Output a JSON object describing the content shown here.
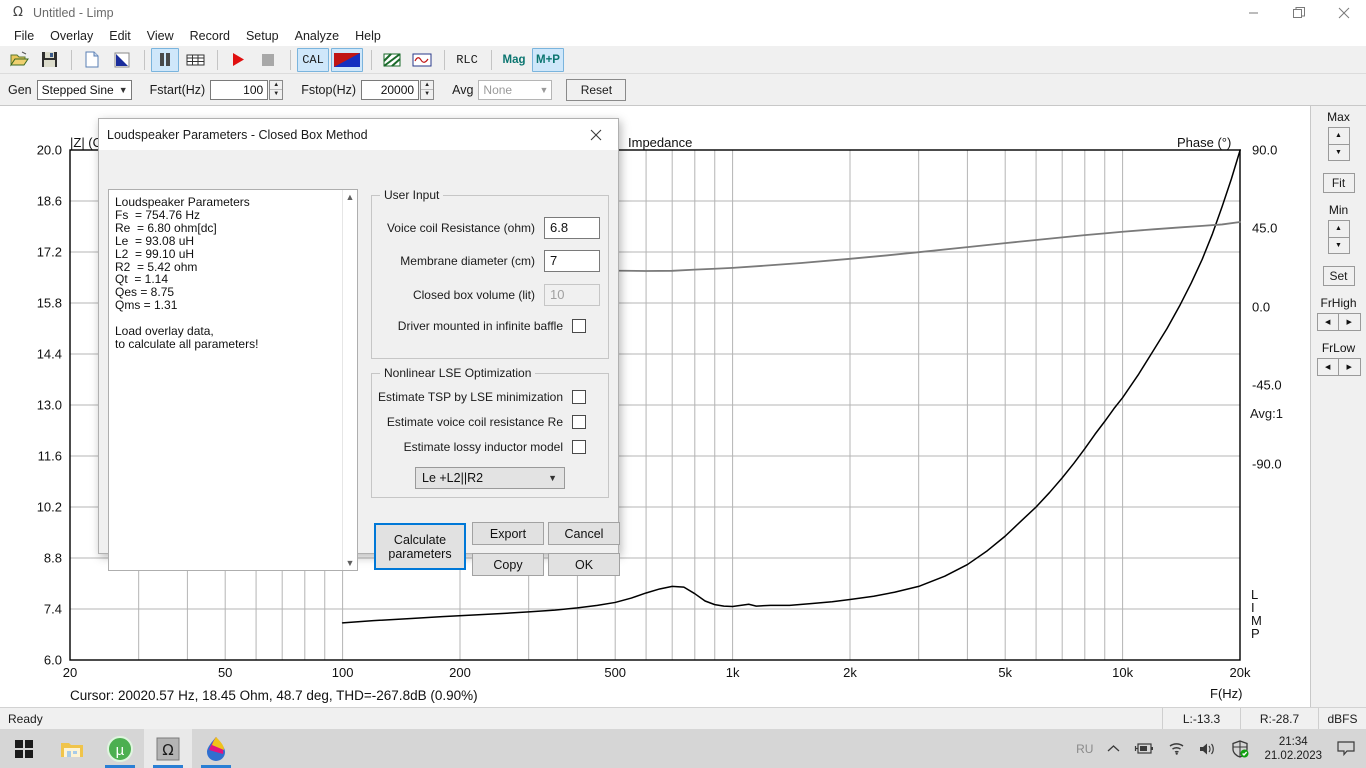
{
  "window": {
    "title": "Untitled - Limp",
    "app_icon": "omega-icon",
    "minimize": "minimize-icon",
    "maximize": "maximize-icon",
    "close": "close-icon"
  },
  "menu": [
    "File",
    "Overlay",
    "Edit",
    "View",
    "Record",
    "Setup",
    "Analyze",
    "Help"
  ],
  "toolbar": {
    "buttons": [
      {
        "name": "open-icon",
        "label": ""
      },
      {
        "name": "save-icon",
        "label": ""
      },
      {
        "name": "new-file-icon",
        "label": ""
      },
      {
        "name": "overlay-icon",
        "label": ""
      },
      {
        "name": "pause-icon",
        "label": "",
        "active": true
      },
      {
        "name": "table-icon",
        "label": ""
      },
      {
        "name": "play-icon",
        "label": ""
      },
      {
        "name": "stop-icon",
        "label": ""
      },
      {
        "name": "cal-icon",
        "label": "CAL",
        "active": true
      },
      {
        "name": "colorbar-icon",
        "label": "",
        "active": true
      },
      {
        "name": "hatched-icon",
        "label": ""
      },
      {
        "name": "waveform-icon",
        "label": ""
      },
      {
        "name": "rlc-icon",
        "label": "RLC"
      },
      {
        "name": "mag-icon",
        "label": "Mag"
      },
      {
        "name": "magphase-icon",
        "label": "M+P",
        "active": true
      }
    ]
  },
  "genbar": {
    "gen_label": "Gen",
    "gen_value": "Stepped Sine",
    "fstart_label": "Fstart(Hz)",
    "fstart_value": "100",
    "fstop_label": "Fstop(Hz)",
    "fstop_value": "20000",
    "avg_label": "Avg",
    "avg_value": "None",
    "reset_label": "Reset"
  },
  "chart_data": {
    "type": "line",
    "title": "Impedance",
    "xlabel": "F(Hz)",
    "ylabel": "|Z| (Ohm)",
    "ylabel_right": "Phase (°)",
    "xscale": "log",
    "xlim": [
      20,
      20000
    ],
    "xticks": [
      20,
      50,
      100,
      200,
      500,
      1000,
      2000,
      5000,
      10000,
      20000
    ],
    "xticklabels": [
      "20",
      "50",
      "100",
      "200",
      "500",
      "1k",
      "2k",
      "5k",
      "10k",
      "20k"
    ],
    "ylim": [
      6.0,
      20.0
    ],
    "yticks": [
      6.0,
      7.4,
      8.8,
      10.2,
      11.6,
      13.0,
      14.4,
      15.8,
      17.2,
      18.6,
      20.0
    ],
    "yticklabels": [
      "6.0",
      "7.4",
      "8.8",
      "10.2",
      "11.6",
      "13.0",
      "14.4",
      "15.8",
      "17.2",
      "18.6",
      "20.0"
    ],
    "ylim_right": [
      -202.5,
      90.0
    ],
    "yticks_right": [
      90.0,
      45.0,
      0.0,
      -45.0,
      -90.0
    ],
    "yticklabels_right": [
      "90.0",
      "45.0",
      "0.0",
      "-45.0",
      "-90.0"
    ],
    "grid": true,
    "avg_label": "Avg:1",
    "watermark": "LIMP",
    "series": [
      {
        "name": "Impedance magnitude",
        "color": "#000000",
        "unit": "Ohm",
        "points": [
          [
            100,
            7.02
          ],
          [
            120,
            7.08
          ],
          [
            150,
            7.14
          ],
          [
            180,
            7.19
          ],
          [
            220,
            7.24
          ],
          [
            260,
            7.28
          ],
          [
            300,
            7.32
          ],
          [
            350,
            7.37
          ],
          [
            400,
            7.43
          ],
          [
            450,
            7.5
          ],
          [
            500,
            7.58
          ],
          [
            550,
            7.7
          ],
          [
            600,
            7.84
          ],
          [
            650,
            7.95
          ],
          [
            700,
            8.02
          ],
          [
            750,
            8.0
          ],
          [
            800,
            7.82
          ],
          [
            850,
            7.62
          ],
          [
            900,
            7.52
          ],
          [
            950,
            7.48
          ],
          [
            1000,
            7.47
          ],
          [
            1100,
            7.53
          ],
          [
            1150,
            7.48
          ],
          [
            1250,
            7.5
          ],
          [
            1400,
            7.5
          ],
          [
            1600,
            7.55
          ],
          [
            1800,
            7.6
          ],
          [
            2000,
            7.66
          ],
          [
            2300,
            7.75
          ],
          [
            2600,
            7.86
          ],
          [
            3000,
            8.02
          ],
          [
            3500,
            8.3
          ],
          [
            4000,
            8.62
          ],
          [
            4500,
            9.0
          ],
          [
            5000,
            9.4
          ],
          [
            5500,
            9.82
          ],
          [
            6000,
            10.2
          ],
          [
            6500,
            10.6
          ],
          [
            7000,
            11.0
          ],
          [
            7500,
            11.4
          ],
          [
            8000,
            11.8
          ],
          [
            8500,
            12.2
          ],
          [
            9000,
            12.55
          ],
          [
            9500,
            12.9
          ],
          [
            10000,
            13.2
          ],
          [
            11000,
            13.85
          ],
          [
            12000,
            14.5
          ],
          [
            13000,
            15.1
          ],
          [
            14000,
            15.72
          ],
          [
            15000,
            16.35
          ],
          [
            16000,
            17.0
          ],
          [
            17000,
            17.7
          ],
          [
            18000,
            18.45
          ],
          [
            19000,
            19.2
          ],
          [
            20020,
            20.0
          ]
        ]
      },
      {
        "name": "Phase",
        "color": "#7a7a7a",
        "unit": "deg",
        "points": [
          [
            100,
            23.0
          ],
          [
            150,
            23.2
          ],
          [
            200,
            23.0
          ],
          [
            300,
            22.4
          ],
          [
            400,
            21.6
          ],
          [
            500,
            20.8
          ],
          [
            600,
            20.6
          ],
          [
            700,
            20.7
          ],
          [
            800,
            21.4
          ],
          [
            900,
            21.9
          ],
          [
            1000,
            22.4
          ],
          [
            1200,
            23.6
          ],
          [
            1500,
            25.2
          ],
          [
            2000,
            27.6
          ],
          [
            2500,
            29.6
          ],
          [
            3000,
            31.4
          ],
          [
            4000,
            34.3
          ],
          [
            5000,
            36.6
          ],
          [
            6000,
            38.4
          ],
          [
            7000,
            39.9
          ],
          [
            8000,
            41.2
          ],
          [
            9000,
            42.2
          ],
          [
            10000,
            43.1
          ],
          [
            12000,
            44.5
          ],
          [
            14000,
            45.6
          ],
          [
            16000,
            46.5
          ],
          [
            18000,
            47.3
          ],
          [
            20020,
            48.7
          ]
        ]
      }
    ],
    "cursor": "Cursor: 20020.57 Hz, 18.45 Ohm, 48.7 deg, THD=-267.8dB (0.90%)"
  },
  "sidepanel": {
    "max_label": "Max",
    "fit_label": "Fit",
    "min_label": "Min",
    "set_label": "Set",
    "frhigh_label": "FrHigh",
    "frlow_label": "FrLow"
  },
  "statusbar": {
    "ready": "Ready",
    "left_level": "L:-13.3",
    "right_level": "R:-28.7",
    "unit": "dBFS"
  },
  "taskbar": {
    "items": [
      {
        "name": "start-button",
        "icon": "windows-logo-icon"
      },
      {
        "name": "file-explorer-button",
        "icon": "folder-icon"
      },
      {
        "name": "utorrent-button",
        "icon": "utorrent-icon"
      },
      {
        "name": "limp-button",
        "icon": "omega-icon"
      },
      {
        "name": "paint-net-button",
        "icon": "paint-drop-icon"
      }
    ],
    "language": "RU",
    "tray_icons": [
      "chevron-up-icon",
      "battery-icon",
      "wifi-icon",
      "volume-icon",
      "security-shield-icon",
      "notifications-icon"
    ],
    "time": "21:34",
    "date": "21.02.2023"
  },
  "dialog": {
    "title": "Loudspeaker Parameters - Closed Box Method",
    "close_icon": "close-icon",
    "parameters_text": "Loudspeaker Parameters\nFs  = 754.76 Hz\nRe  = 6.80 ohm[dc]\nLe  = 93.08 uH\nL2  = 99.10 uH\nR2  = 5.42 ohm\nQt  = 1.14\nQes = 8.75\nQms = 1.31\n\nLoad overlay data,\nto calculate all parameters!",
    "user_input": {
      "legend": "User Input",
      "voice_coil_label": "Voice coil Resistance (ohm)",
      "voice_coil_value": "6.8",
      "membrane_label": "Membrane diameter (cm)",
      "membrane_value": "7",
      "boxvol_label": "Closed box volume (lit)",
      "boxvol_value": "10",
      "baffle_label": "Driver mounted in infinite baffle"
    },
    "lse": {
      "legend": "Nonlinear LSE Optimization",
      "tsp_label": "Estimate TSP by LSE minimization",
      "re_label": "Estimate voice coil resistance Re",
      "inductor_label": "Estimate lossy inductor model",
      "model_value": "Le +L2||R2"
    },
    "buttons": {
      "calculate": "Calculate\nparameters",
      "export": "Export",
      "cancel": "Cancel",
      "copy": "Copy",
      "ok": "OK"
    }
  }
}
